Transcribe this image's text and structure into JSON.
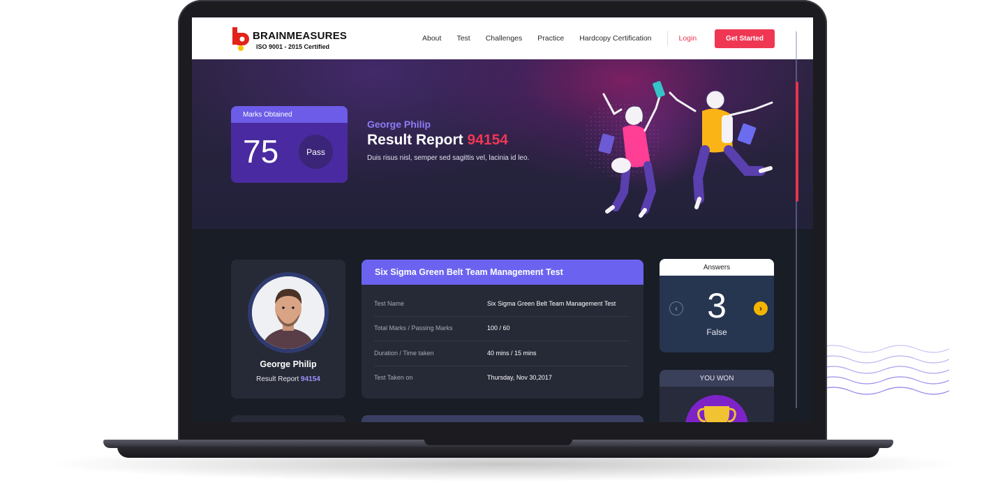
{
  "brand": {
    "name": "BRAINMEASURES",
    "tagline": "ISO 9001 - 2015 Certified",
    "accent": "#ef3653"
  },
  "nav": {
    "links": [
      "About",
      "Test",
      "Challenges",
      "Practice",
      "Hardcopy Certification"
    ],
    "login": "Login",
    "cta": "Get Started"
  },
  "hero": {
    "marks_label": "Marks Obtained",
    "marks_value": "75",
    "status": "Pass",
    "name": "George Philip",
    "title": "Result Report",
    "report_number": "94154",
    "description": "Duis risus nisl, semper sed sagittis vel, lacinia id leo."
  },
  "profile": {
    "name": "George Philip",
    "report_label": "Result Report",
    "report_number": "94154"
  },
  "test": {
    "title": "Six Sigma Green Belt Team Management Test",
    "rows": [
      {
        "label": "Test Name",
        "value": "Six Sigma Green Belt Team Management Test"
      },
      {
        "label": "Total Marks / Passing Marks",
        "value": "100 / 60"
      },
      {
        "label": "Duration / Time taken",
        "value": "40 mins / 15 mins"
      },
      {
        "label": "Test Taken on",
        "value": "Thursday, Nov 30,2017"
      }
    ]
  },
  "answers": {
    "title": "Answers",
    "number": "3",
    "result": "False",
    "prev_icon": "chevron-left-icon",
    "next_icon": "chevron-right-icon"
  },
  "won": {
    "title": "YOU WON",
    "icon": "trophy-icon"
  }
}
